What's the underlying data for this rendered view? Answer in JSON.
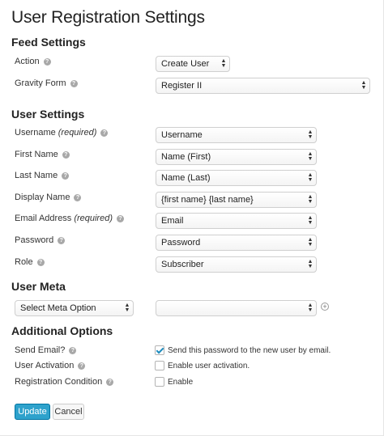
{
  "page": {
    "title": "User Registration Settings"
  },
  "feed_settings": {
    "heading": "Feed Settings",
    "action": {
      "label": "Action",
      "value": "Create User"
    },
    "gravity_form": {
      "label": "Gravity Form",
      "value": "Register II"
    }
  },
  "user_settings": {
    "heading": "User Settings",
    "username": {
      "label": "Username",
      "req": "(required)",
      "value": "Username"
    },
    "first_name": {
      "label": "First Name",
      "value": "Name (First)"
    },
    "last_name": {
      "label": "Last Name",
      "value": "Name (Last)"
    },
    "display_name": {
      "label": "Display Name",
      "value": "{first name} {last name}"
    },
    "email_address": {
      "label": "Email Address",
      "req": "(required)",
      "value": "Email"
    },
    "password": {
      "label": "Password",
      "value": "Password"
    },
    "role": {
      "label": "Role",
      "value": "Subscriber"
    }
  },
  "user_meta": {
    "heading": "User Meta",
    "meta_option": {
      "value": "Select Meta Option"
    },
    "meta_value": {
      "value": ""
    }
  },
  "additional_options": {
    "heading": "Additional Options",
    "send_email": {
      "label": "Send Email?",
      "checkbox_label": "Send this password to the new user by email.",
      "checked": true
    },
    "user_activation": {
      "label": "User Activation",
      "checkbox_label": "Enable user activation.",
      "checked": false
    },
    "registration_condition": {
      "label": "Registration Condition",
      "checkbox_label": "Enable",
      "checked": false
    }
  },
  "buttons": {
    "update": "Update",
    "cancel": "Cancel"
  },
  "icons": {
    "help": "question-circle-icon",
    "select_arrow": "up-down-arrow-icon",
    "add": "plus-circle-icon",
    "check": "checkmark-icon"
  },
  "colors": {
    "primary": "#2ea2cc",
    "primary_border": "#0074a2",
    "check": "#1e8cbe"
  }
}
